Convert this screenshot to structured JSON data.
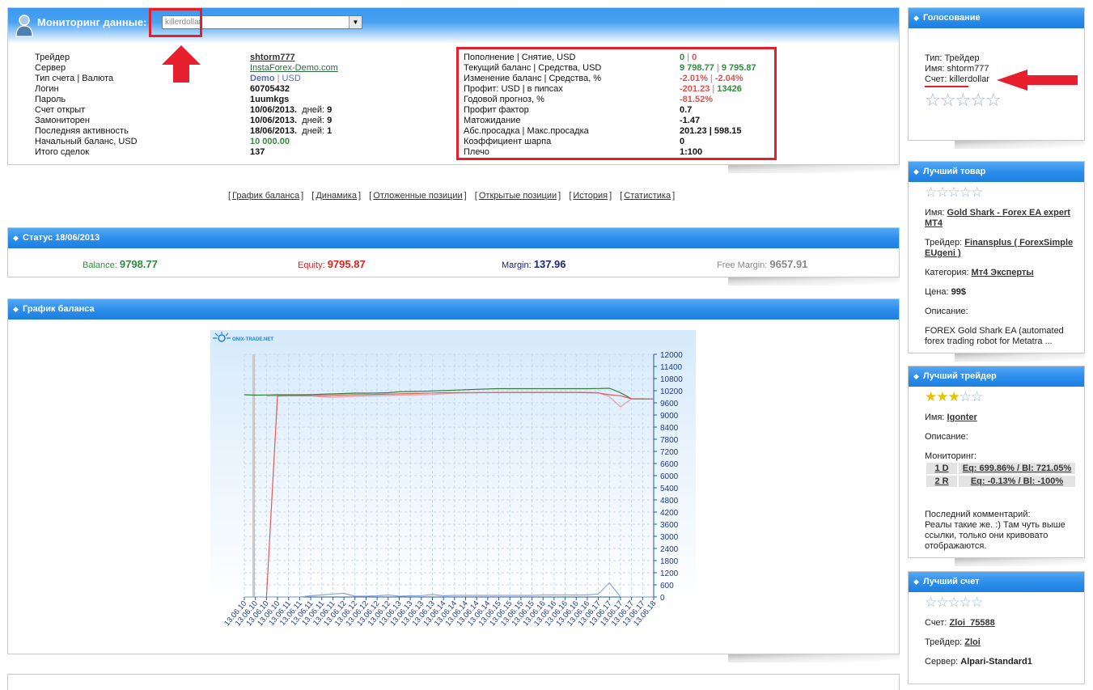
{
  "monitoring": {
    "title": "Мониторинг данные:",
    "selected_account": "killerdollar",
    "fields_left": [
      {
        "label": "Трейдер",
        "value": "shtorm777"
      },
      {
        "label": "Сервер",
        "value": "InstaForex-Demo.com"
      },
      {
        "label": "Тип счета | Валюта",
        "value_a": "Demo",
        "value_b": "USD"
      },
      {
        "label": "Логин",
        "value": "60705432"
      },
      {
        "label": "Пароль",
        "value": "1uumkgs"
      },
      {
        "label": "Счет открыт",
        "value": "10/06/2013.",
        "days_label": "дней:",
        "days": "9"
      },
      {
        "label": "Замониторен",
        "value": "10/06/2013.",
        "days_label": "дней:",
        "days": "9"
      },
      {
        "label": "Последняя активность",
        "value": "18/06/2013.",
        "days_label": "дней:",
        "days": "1"
      },
      {
        "label": "Начальный баланс, USD",
        "value": "10 000.00"
      },
      {
        "label": "Итого сделок",
        "value": "137"
      }
    ],
    "fields_right": [
      {
        "label": "Пополнение | Снятие, USD",
        "value_a": "0",
        "value_b": "0"
      },
      {
        "label": "Текущий баланс | Средства, USD",
        "value_a": "9 798.77",
        "value_b": "9 795.87"
      },
      {
        "label": "Изменение баланс | Средства, %",
        "value_a": "-2.01%",
        "value_b": "-2.04%"
      },
      {
        "label": "Профит: USD | в пипсах",
        "value_a": "-201.23",
        "value_b": "13426"
      },
      {
        "label": "Годовой прогноз, %",
        "value": "-81.52%"
      },
      {
        "label": "Профит фактор",
        "value": "0.7"
      },
      {
        "label": "Матожидание",
        "value": "-1.47"
      },
      {
        "label": "Абс.просадка | Макс.просадка",
        "value": "201.23 | 598.15"
      },
      {
        "label": "Коэффициент шарпа",
        "value": "0"
      },
      {
        "label": "Плечо",
        "value": "1:100"
      }
    ]
  },
  "nav_links": [
    "График баланса",
    "Динамика",
    "Отложенные позиции",
    "Открытые позиции",
    "История",
    "Статистика"
  ],
  "status": {
    "title": "Статус 18/06/2013",
    "balance_label": "Balance:",
    "balance": "9798.77",
    "equity_label": "Equity:",
    "equity": "9795.87",
    "margin_label": "Margin:",
    "margin": "137.96",
    "free_margin_label": "Free Margin:",
    "free_margin": "9657.91"
  },
  "balance_chart_panel": {
    "title": "График баланса"
  },
  "chart_data": {
    "type": "line",
    "watermark": "ONIX-TRADE.NET",
    "x": [
      "13.06.10",
      "13.06.10",
      "13.06.10",
      "13.06.10",
      "13.06.11",
      "13.06.11",
      "13.06.11",
      "13.06.11",
      "13.06.11",
      "13.06.12",
      "13.06.12",
      "13.06.12",
      "13.06.12",
      "13.06.12",
      "13.06.13",
      "13.06.13",
      "13.06.13",
      "13.06.13",
      "13.06.14",
      "13.06.14",
      "13.06.14",
      "13.06.14",
      "13.06.14",
      "13.06.15",
      "13.06.15",
      "13.06.15",
      "13.06.15",
      "13.06.16",
      "13.06.16",
      "13.06.16",
      "13.06.16",
      "13.06.16",
      "13.06.17",
      "13.06.17",
      "13.06.17",
      "13.06.17",
      "13.06.17",
      "13.06.18"
    ],
    "yticks": [
      0,
      600,
      1200,
      1800,
      2400,
      3000,
      3600,
      4200,
      4800,
      5400,
      6000,
      6600,
      7200,
      7800,
      8400,
      9000,
      9600,
      10200,
      10800,
      11400,
      12000
    ],
    "ylim": [
      0,
      12000
    ],
    "series": [
      {
        "color": "#2e7d32",
        "values": [
          10000,
          9980,
          9990,
          10000,
          10000,
          10000,
          10010,
          10030,
          10040,
          10060,
          10080,
          10080,
          10090,
          10100,
          10150,
          10160,
          10170,
          10190,
          10210,
          10230,
          10250,
          10270,
          10290,
          10300,
          10300,
          10300,
          10300,
          10300,
          10300,
          10300,
          10300,
          10300,
          10310,
          10320,
          10100,
          9800,
          9800,
          9790
        ]
      },
      {
        "color": "#d9a0a8",
        "values": [
          null,
          null,
          9940,
          9940,
          9950,
          9950,
          9950,
          9900,
          9880,
          9900,
          9920,
          9940,
          9950,
          9960,
          9980,
          9990,
          10000,
          10010,
          10050,
          10080,
          10090,
          10100,
          10110,
          10120,
          10130,
          10130,
          10130,
          10130,
          10130,
          10130,
          10130,
          10120,
          10110,
          9900,
          9400,
          9800,
          9790,
          9790
        ]
      },
      {
        "color": "#e05a5a",
        "values": [
          null,
          null,
          0,
          9940,
          9950,
          9950,
          9950,
          9960,
          9970,
          9990,
          10000,
          10010,
          10020,
          10030,
          10050,
          10060,
          10070,
          10090,
          10100,
          10110,
          10110,
          10110,
          10110,
          10110,
          10110,
          10110,
          10110,
          10110,
          10110,
          10110,
          10110,
          10100,
          10090,
          10000,
          9950,
          9800,
          9790,
          9790
        ]
      },
      {
        "color": "#8fa8d6",
        "values": [
          0,
          0,
          0,
          0,
          0,
          0,
          60,
          100,
          150,
          180,
          40,
          40,
          60,
          100,
          40,
          60,
          70,
          120,
          60,
          80,
          80,
          80,
          80,
          80,
          80,
          80,
          80,
          100,
          100,
          100,
          100,
          100,
          150,
          700,
          0,
          0,
          0,
          0
        ]
      }
    ]
  },
  "vote": {
    "title": "Голосование",
    "type": "Тип: Трейдер",
    "name": "Имя: shtorm777",
    "account": "Счет: killerdollar",
    "stars_on": 0
  },
  "best_product": {
    "title": "Лучший товар",
    "name_label": "Имя:",
    "name": "Gold Shark - Forex EA expert MT4",
    "trader_label": "Трейдер:",
    "trader": "Finansplus ( ForexSimple EUgeni )",
    "category_label": "Категория:",
    "category": "Mт4 Эксперты",
    "price_label": "Цена:",
    "price": "99$",
    "desc_label": "Описание:",
    "desc": "FOREX Gold Shark  EA (automated forex trading robot for Metatra ..."
  },
  "best_trader": {
    "title": "Лучший трейдер",
    "stars_on": 3,
    "name_label": "Имя:",
    "name": "Igonter",
    "desc_label": "Описание:",
    "monitoring_label": "Мониторинг:",
    "rows": [
      {
        "account": "1 D",
        "stats": "Eq: 699.86% / Bl: 721.05%"
      },
      {
        "account": "2 R",
        "stats": "Eq: -0.13% / Bl: -100%"
      }
    ],
    "comment_label": "Последний комментарий:",
    "comment": "Реалы такие же. :) Там чуть выше ссылки, только они кривовато отображаются."
  },
  "best_account": {
    "title": "Лучший счет",
    "account_label": "Счет:",
    "account": "Zloi_75588",
    "trader_label": "Трейдер:",
    "trader": "Zloi",
    "server_label": "Сервер:",
    "server": "Alpari-Standard1"
  }
}
